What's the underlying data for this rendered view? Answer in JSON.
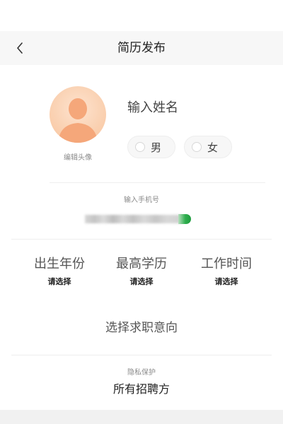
{
  "nav": {
    "title": "简历发布",
    "back_icon": "chevron-left-icon"
  },
  "profile": {
    "avatar_caption": "编辑头像",
    "name_placeholder": "输入姓名",
    "gender_options": [
      {
        "label": "男"
      },
      {
        "label": "女"
      }
    ]
  },
  "phone": {
    "caption": "输入手机号",
    "value_state": "blurred"
  },
  "selectors": [
    {
      "title": "出生年份",
      "value": "请选择"
    },
    {
      "title": "最高学历",
      "value": "请选择"
    },
    {
      "title": "工作时间",
      "value": "请选择"
    }
  ],
  "job_intention": {
    "label": "选择求职意向"
  },
  "privacy": {
    "caption": "隐私保护",
    "value": "所有招聘方"
  },
  "colors": {
    "nav_bg": "#f7f7f7",
    "avatar_bg": "#fbd9c0",
    "avatar_figure": "#f5a77a",
    "phone_accent": "#2fae4e",
    "divider": "#eeeeee",
    "caption_text": "#8a8a8a"
  }
}
